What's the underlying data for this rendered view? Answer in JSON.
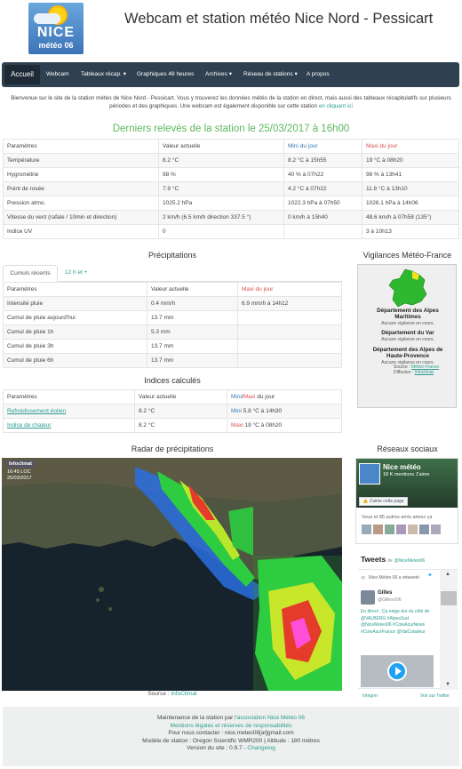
{
  "logo": {
    "brand": "NICE",
    "sub": "météo 06"
  },
  "header": {
    "title": "Webcam et station météo Nice Nord - Pessicart"
  },
  "nav": {
    "items": [
      "Accueil",
      "Webcam",
      "Tableaux récap.",
      "Graphiques 48 heures",
      "Archives",
      "Réseau de stations",
      "A propos"
    ]
  },
  "intro": {
    "text": "Bienvenue sur le site de la station météo de Nice Nord - Pessicart. Vous y trouverez les données météo de la station en direct, mais aussi des tableaux récapitulatifs sur plusieurs périodes et des graphiques. Une webcam est également disponible sur cette station",
    "link": "en cliquant ici"
  },
  "releves": {
    "title": "Derniers relevés de la station le 25/03/2017 à 16h00",
    "headers": [
      "Paramètres",
      "Valeur actuelle",
      "Mini du jour",
      "Maxi du jour"
    ],
    "rows": [
      [
        "Température",
        "8.2 °C",
        "8.2 °C à 15h55",
        "19 °C à 08h20"
      ],
      [
        "Hygrométrie",
        "98 %",
        "40 % à 07h22",
        "98 % à 13h41"
      ],
      [
        "Point de rosée",
        "7.9 °C",
        "4.2 °C à 07h22",
        "11.8 °C à 13h10"
      ],
      [
        "Pression atmo.",
        "1025.2 hPa",
        "1022.3 hPa à 07h50",
        "1026.1 hPa à 14h06"
      ],
      [
        "Vitesse du vent (rafale / 10min et direction)",
        "2 km/h (6.5 km/h direction 337.5 °)",
        "0 km/h à 15h40",
        "48.6 km/h à 07h58 (135°)"
      ],
      [
        "Indice UV",
        "0",
        "",
        "3 à 10h13"
      ]
    ]
  },
  "precip": {
    "title": "Précipitations",
    "tabs": [
      "Cumuls récents",
      "12 h et +"
    ],
    "headers": [
      "Paramètres",
      "Valeur actuelle",
      "Maxi du jour"
    ],
    "rows": [
      [
        "Intensité pluie",
        "0.4 mm/h",
        "6.9 mm/h à 14h12"
      ],
      [
        "Cumul de pluie aujourd'hui",
        "13.7 mm",
        ""
      ],
      [
        "Cumul de pluie 1h",
        "5.3 mm",
        ""
      ],
      [
        "Cumul de pluie 3h",
        "13.7 mm",
        ""
      ],
      [
        "Cumul de pluie 6h",
        "13.7 mm",
        ""
      ]
    ]
  },
  "indices": {
    "title": "Indices calculés",
    "headers": [
      "Paramètres",
      "Valeur actuelle",
      "Mini",
      "/",
      "Maxi",
      " du jour"
    ],
    "rows": [
      [
        "Refroidissement éolien",
        "8.2 °C",
        "Mini",
        " 5.8 °C à 14h30"
      ],
      [
        "Indice de chaleur",
        "8.2 °C",
        "Maxi",
        " 19 °C à 08h20"
      ]
    ]
  },
  "vigilance": {
    "title": "Vigilances Météo-France",
    "depts": [
      {
        "name": "Département des Alpes Maritimes",
        "status": "Aucune vigilance en cours."
      },
      {
        "name": "Département du Var",
        "status": "Aucune vigilance en cours."
      },
      {
        "name": "Département des Alpes de Haute-Provence",
        "status": "Aucune vigilance en cours."
      }
    ],
    "source_label": "Source :",
    "source": "Météo-France",
    "diff_label": "Diffusion :",
    "diff": "Infoclimat"
  },
  "radar": {
    "title": "Radar de précipitations",
    "badge": "Infoclimat",
    "time": "16:45 LOC",
    "date": "25/03/2017",
    "source_label": "Source :",
    "source": "InfoClimat"
  },
  "social": {
    "title": "Réseaux sociaux",
    "fb": {
      "name": "Nice météo",
      "likes": "18 K mentions J'aime",
      "like_btn": "J'aime cette page",
      "friends": "Vous et 85 autres amis aimez ça"
    },
    "tw": {
      "title": "Tweets",
      "by": "de",
      "handle": "@NiceMeteo06",
      "rt": "Nice Météo 06 a retweeté",
      "user": "Gilles",
      "user_handle": "@GillesV06",
      "text": "En direct : Ça neige dur du côté de @VALBERG #AlpesSud @NiceMeteo06 #CoteAzurNews #CoteAzurFrance @ValColadeur",
      "embed": "Intégrer",
      "view": "Voir sur Twitter"
    }
  },
  "footer": {
    "line1_prefix": "Maintenance de la station par",
    "line1_link": "l'association Nice Météo 06",
    "line2": "Mentions légales et réserves de responsabilités",
    "line3": "Pour nous contacter : nice.meteo06[at]gmail.com",
    "line4": "Modèle de station : Oregon Scientific WMR200 | Altitude : 180 mètres",
    "line5_prefix": "Version du site : 0.9.7 -",
    "line5_link": "Changelog"
  },
  "colors": {
    "accent": "#5cb85c",
    "nav_bg": "#2f4050",
    "link": "#2a9d8f",
    "max": "#d9534f",
    "min": "#337ab7"
  }
}
